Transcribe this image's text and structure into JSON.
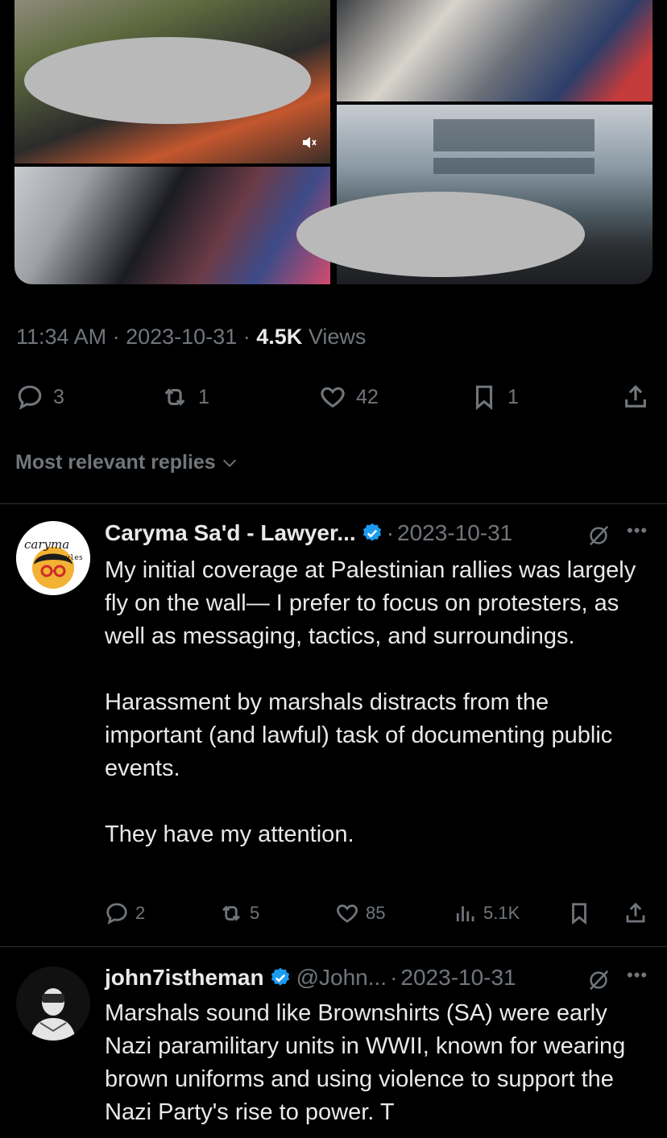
{
  "tweet": {
    "time": "11:34 AM",
    "date": "2023-10-31",
    "separator": "·",
    "views_count": "4.5K",
    "views_label": "Views",
    "actions": {
      "replies": "3",
      "reposts": "1",
      "likes": "42",
      "bookmarks": "1"
    }
  },
  "sort": {
    "label": "Most relevant replies"
  },
  "replies": [
    {
      "author": "Caryma Sa'd - Lawyer...",
      "handle": "",
      "date": "2023-10-31",
      "verified": true,
      "avatar_text": "caryma",
      "avatar_subtext": "rules",
      "paragraphs": [
        "My initial coverage at Palestinian rallies was largely fly on the wall— I prefer to focus on protesters, as well as messaging, tactics, and surroundings.",
        "Harassment by marshals distracts from the important (and lawful) task of documenting public events.",
        "They have my attention."
      ],
      "actions": {
        "replies": "2",
        "reposts": "5",
        "likes": "85",
        "views": "5.1K"
      }
    },
    {
      "author": "john7istheman",
      "handle": "@John...",
      "date": "2023-10-31",
      "verified": true,
      "paragraphs": [
        "Marshals sound like Brownshirts (SA) were early Nazi paramilitary units in WWII, known for wearing brown uniforms and using violence to support the Nazi Party's rise to power. T"
      ]
    }
  ],
  "colors": {
    "background": "#000000",
    "text": "#e7e9ea",
    "muted": "#71767b",
    "verified": "#1d9bf0",
    "divider": "#2f3336"
  }
}
